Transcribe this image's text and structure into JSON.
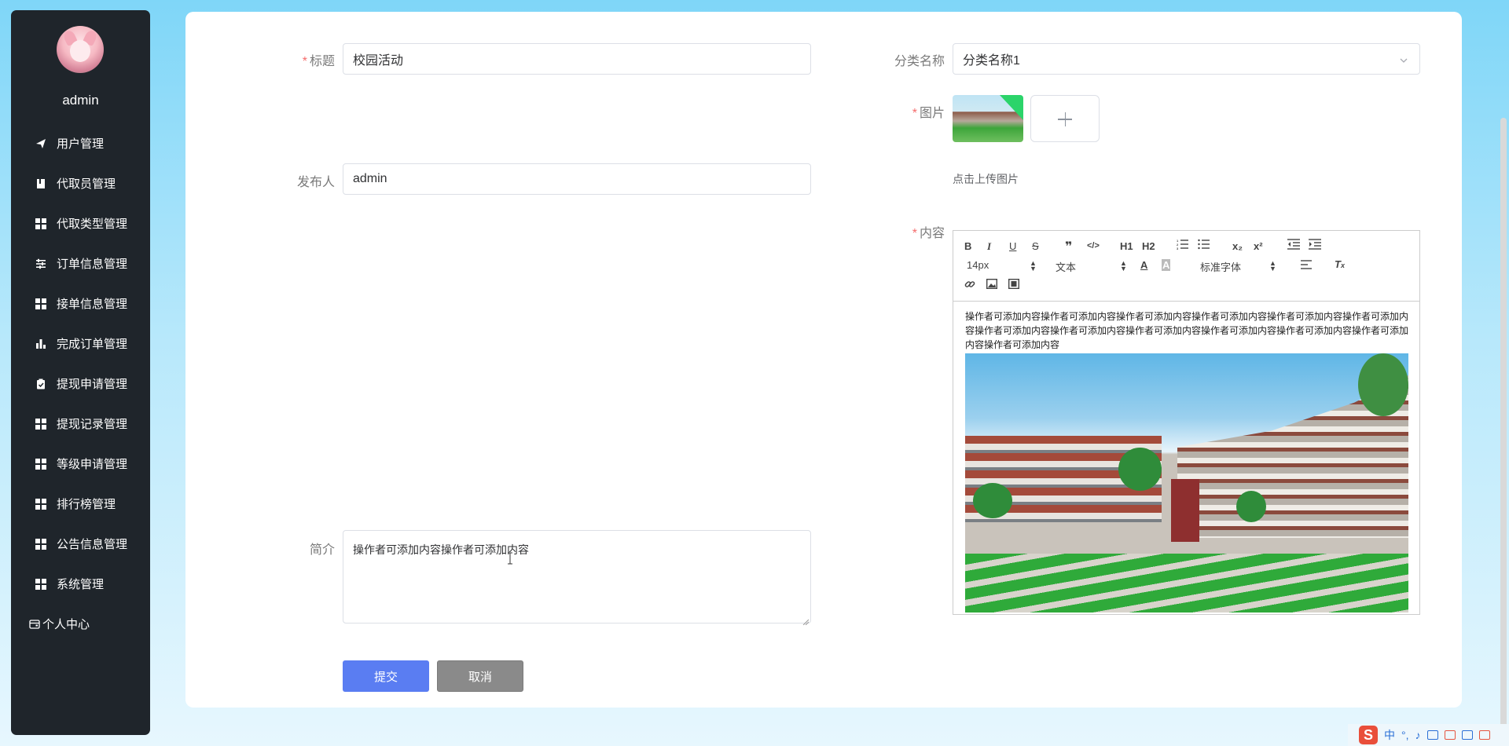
{
  "user": {
    "name": "admin"
  },
  "sidebar": {
    "items": [
      {
        "label": "用户管理",
        "icon": "send-icon"
      },
      {
        "label": "代取员管理",
        "icon": "book-icon"
      },
      {
        "label": "代取类型管理",
        "icon": "grid-icon"
      },
      {
        "label": "订单信息管理",
        "icon": "sliders-icon"
      },
      {
        "label": "接单信息管理",
        "icon": "grid-icon"
      },
      {
        "label": "完成订单管理",
        "icon": "bar-chart-icon"
      },
      {
        "label": "提现申请管理",
        "icon": "clipboard-icon"
      },
      {
        "label": "提现记录管理",
        "icon": "grid-icon"
      },
      {
        "label": "等级申请管理",
        "icon": "grid-icon"
      },
      {
        "label": "排行榜管理",
        "icon": "grid-icon"
      },
      {
        "label": "公告信息管理",
        "icon": "grid-icon"
      },
      {
        "label": "系统管理",
        "icon": "grid-icon"
      },
      {
        "label": "个人中心",
        "icon": "wallet-icon"
      }
    ]
  },
  "form": {
    "title": {
      "label": "标题",
      "value": "校园活动"
    },
    "category": {
      "label": "分类名称",
      "value": "分类名称1"
    },
    "image": {
      "label": "图片",
      "hint": "点击上传图片"
    },
    "publisher": {
      "label": "发布人",
      "value": "admin"
    },
    "content": {
      "label": "内容",
      "text": "操作者可添加内容操作者可添加内容操作者可添加内容操作者可添加内容操作者可添加内容操作者可添加内容操作者可添加内容操作者可添加内容操作者可添加内容操作者可添加内容操作者可添加内容操作者可添加内容操作者可添加内容"
    },
    "summary": {
      "label": "简介",
      "value": "操作者可添加内容操作者可添加内容"
    }
  },
  "editor_toolbar": {
    "bold": "B",
    "italic": "I",
    "underline": "U",
    "strike": "S",
    "quote": "❞",
    "code": "</>",
    "h1": "H1",
    "h2": "H2",
    "subscript": "x₂",
    "superscript": "x²",
    "size": "14px",
    "header": "文本",
    "font": "标准字体"
  },
  "buttons": {
    "submit": "提交",
    "cancel": "取消"
  },
  "tray": {
    "ime_logo": "S",
    "ime_lang": "中",
    "ime_punct": "°,"
  },
  "colors": {
    "primary": "#5a7df2",
    "sidebar": "#1f252b",
    "required": "#f56c6c"
  }
}
